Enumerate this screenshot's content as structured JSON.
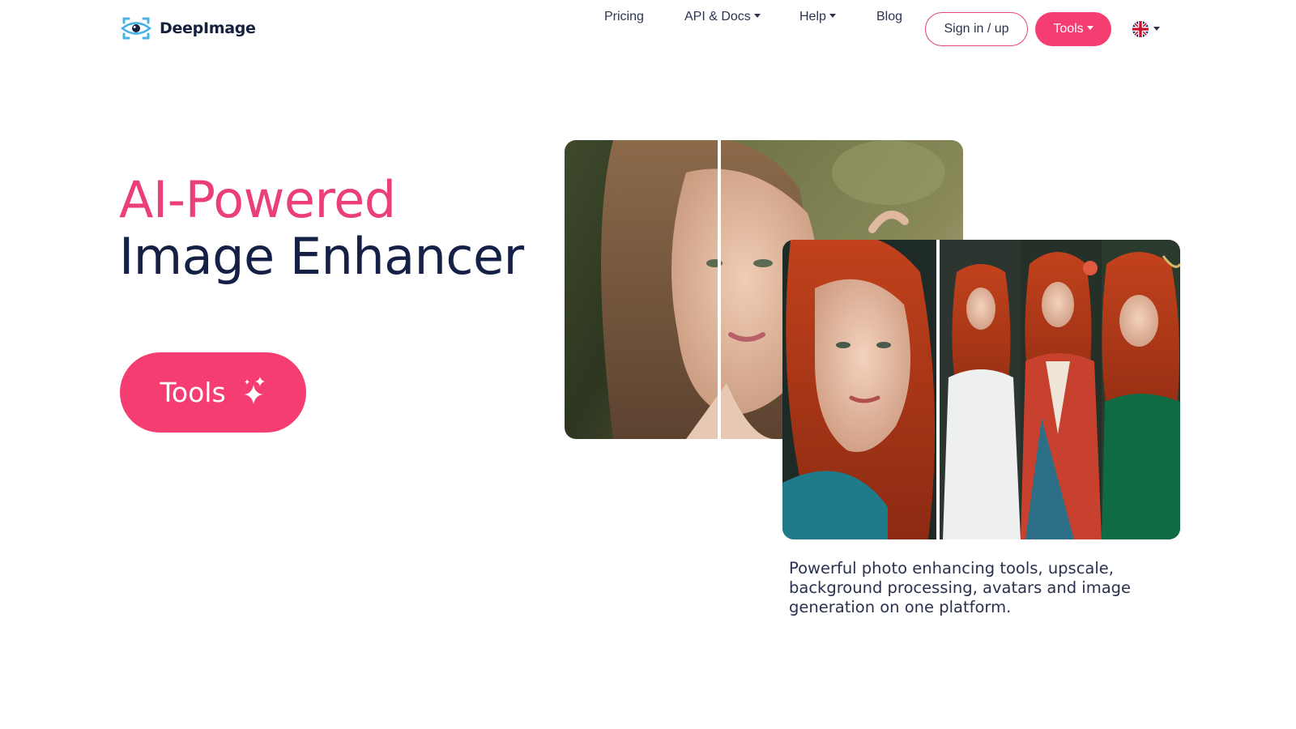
{
  "brand": {
    "name": "DeepImage"
  },
  "nav": {
    "pricing": "Pricing",
    "api_docs": "API & Docs",
    "help": "Help",
    "blog": "Blog",
    "signin": "Sign in / up",
    "tools": "Tools",
    "language_icon": "uk-flag-icon"
  },
  "hero": {
    "title_line1": "AI-Powered",
    "title_line2": "Image Enhancer",
    "cta_label": "Tools",
    "cta_icon": "sparkles-icon"
  },
  "images": {
    "before_after_left": "portrait-before-after",
    "avatars_right": "red-hair-avatars"
  },
  "caption": "Powerful photo enhancing tools, upscale, background processing, avatars and image generation on one platform.",
  "colors": {
    "accent": "#f53d71",
    "accent_text": "#ea3f77",
    "heading": "#142045",
    "logo_blue": "#4ab3e6"
  }
}
